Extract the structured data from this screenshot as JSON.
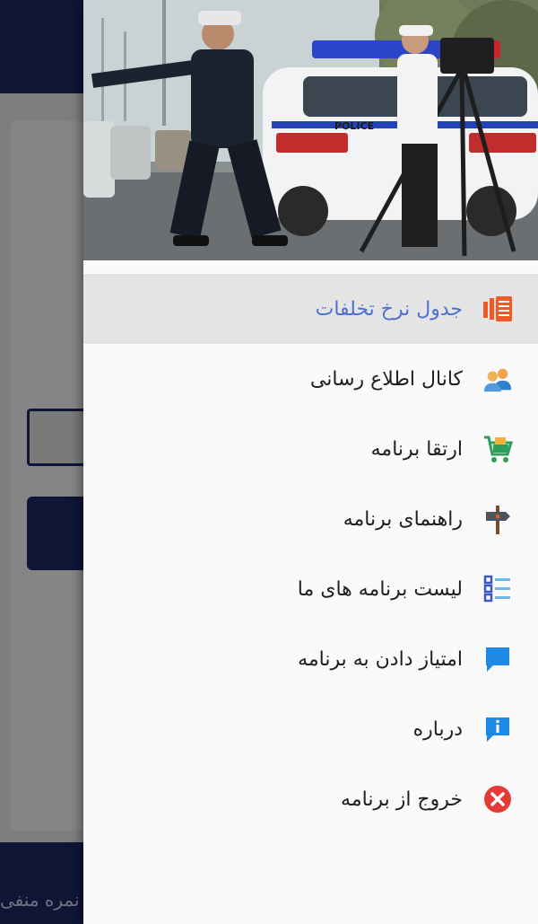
{
  "background": {
    "bottom_text": "نمره منفی"
  },
  "drawer": {
    "header_image": {
      "police_text": "POLICE"
    },
    "menu": [
      {
        "label": "جدول نرخ تخلفات",
        "icon": "fee-table-icon",
        "active": true
      },
      {
        "label": "کانال اطلاع رسانی",
        "icon": "users-icon",
        "active": false
      },
      {
        "label": "ارتقا برنامه",
        "icon": "shopping-cart-icon",
        "active": false
      },
      {
        "label": "راهنمای برنامه",
        "icon": "signpost-icon",
        "active": false
      },
      {
        "label": "لیست برنامه های ما",
        "icon": "list-icon",
        "active": false
      },
      {
        "label": "امتیاز دادن به برنامه",
        "icon": "chat-bubble-icon",
        "active": false
      },
      {
        "label": "درباره",
        "icon": "info-icon",
        "active": false
      },
      {
        "label": "خروج از برنامه",
        "icon": "exit-icon",
        "active": false
      }
    ]
  },
  "colors": {
    "primary": "#1d2a66",
    "active_text": "#4f6fd0",
    "active_bg": "#e4e4e4"
  }
}
